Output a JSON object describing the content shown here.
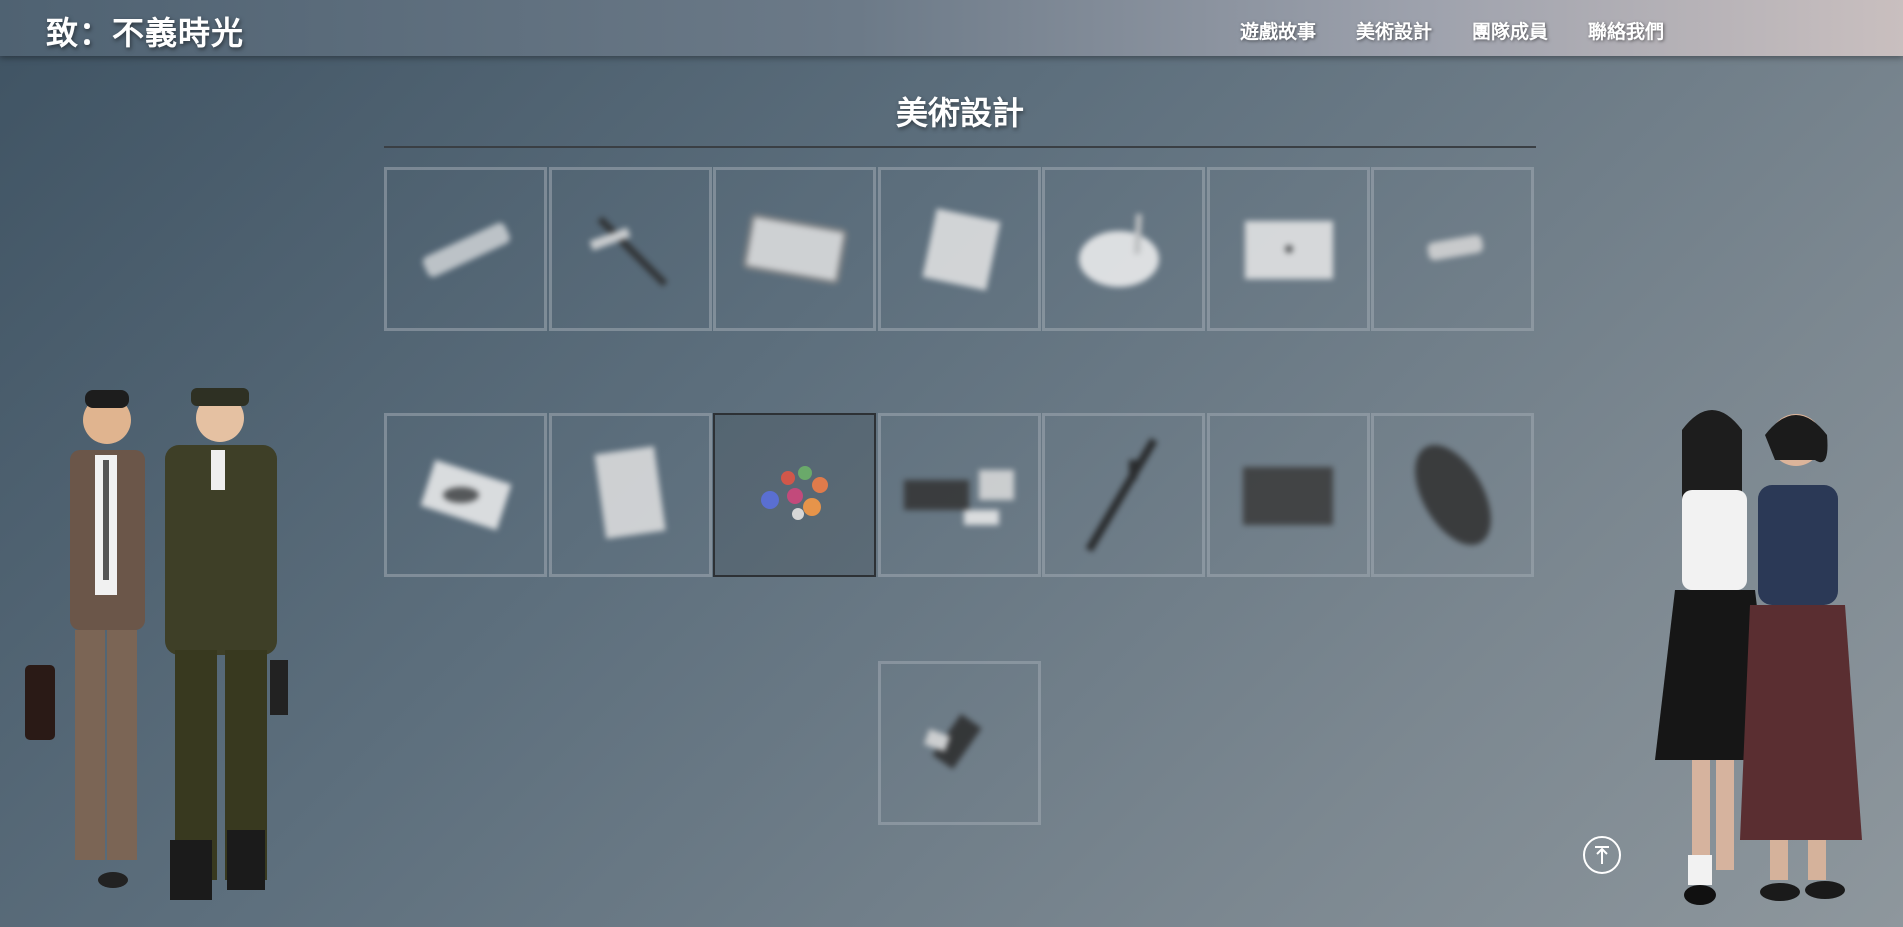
{
  "header": {
    "title": "致：不義時光",
    "nav": [
      "遊戲故事",
      "美術設計",
      "團隊成員",
      "聯絡我們"
    ]
  },
  "section": {
    "title": "美術設計"
  },
  "gallery": {
    "row1": [
      "rolled-paper",
      "brush",
      "banknote",
      "photo",
      "bowl",
      "box",
      "small-object"
    ],
    "row2": [
      "papers",
      "book",
      "candies",
      "wallet-and-cards",
      "rifle",
      "block",
      "sleeping-bag"
    ],
    "row3": [
      "lighter"
    ],
    "active_item": "candies"
  },
  "icons": {
    "back_to_top": "arrow-up-circle-icon"
  },
  "colors": {
    "accent": "#ffffff",
    "grid_border": "#a0aab2"
  }
}
